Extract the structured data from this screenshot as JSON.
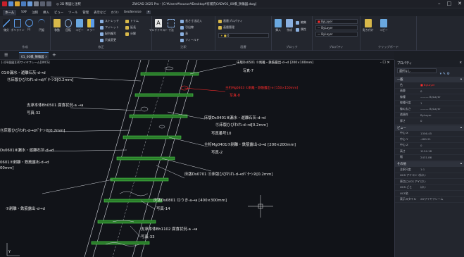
{
  "title_bar": {
    "title": "ZWCAD 2025 Pro - [C:¥Users¥hourun¥Desktop¥有補充CAD¥01_00橋_損傷図.dwg]",
    "tab_label": "◎ 2D 製図と注釈"
  },
  "menu": [
    "ホーム",
    "SXF",
    "注釈",
    "挿入",
    "ビュー",
    "ツール",
    "管理",
    "表示など",
    "ｵﾝﾗｲﾝ",
    "GeoService"
  ],
  "ribbon": {
    "groups": [
      {
        "label": "作成",
        "buttons": [
          "線分",
          "ポリライン",
          "円",
          "円弧"
        ]
      },
      {
        "label": "修正",
        "buttons": [
          "移動",
          "回転",
          "コピー",
          "ミラー",
          "ストレッチ",
          "フィレット",
          "配列複写",
          "尺度変更",
          "トリム",
          "延長",
          "分解"
        ]
      },
      {
        "label": "注釈",
        "buttons": [
          "マルチテキスト",
          "寸法",
          "引出線",
          "表",
          "長さ寸法記入",
          "フィールド"
        ]
      },
      {
        "label": "画層",
        "buttons": [
          "画層プロパティ",
          "画層管理"
        ]
      },
      {
        "label": "ブロック",
        "buttons": [
          "挿入",
          "作成",
          "編集",
          "属性"
        ]
      },
      {
        "label": "プロパティ",
        "buttons": [
          "作成",
          "編集"
        ]
      },
      {
        "label": "ユーティリティ",
        "buttons": [
          "貼り付け"
        ]
      },
      {
        "label": "クリップボード",
        "buttons": [
          "コピー"
        ]
      }
    ],
    "layer_value": "0",
    "bylayer_1": "ByLayer",
    "bylayer_2": "ByLayer",
    "bylayer_3": "ByLayer"
  },
  "doc_tab": "01_00橋_損傷図",
  "canvas": {
    "header": "[-][平面図][2Dワイヤフレーム][WCS]",
    "labels": [
      {
        "text": "床版Ds0501 ①剥離・鉄筋露出-d→d [200×100mm]",
        "color": "#e8e8e8"
      },
      {
        "text": "写真-7",
        "color": "#e8e8e8"
      },
      {
        "text": "01⑧漏水・遊離石灰-d→d",
        "color": "#e8e8e8"
      },
      {
        "text": "⑪床版ひびわれ-d→d/ﾊﾟﾀｰﾝ②[0.2mm]",
        "color": "#e8e8e8"
      },
      {
        "text": "主桁Mg0403 ①剥離・鉄筋露出-e [150×150mm]",
        "color": "#ff2b2b"
      },
      {
        "text": "写真-8",
        "color": "#ff2b2b"
      },
      {
        "text": "支承本体Bh0501 腐食状況-a →a",
        "color": "#e8e8e8"
      },
      {
        "text": "写真-32",
        "color": "#e8e8e8"
      },
      {
        "text": "床版Ds0401⑧漏水・遊離石灰-d→d",
        "color": "#e8e8e8"
      },
      {
        "text": "⑪床版ひびわれ-d→d[0.2mm]",
        "color": "#e8e8e8"
      },
      {
        "text": "写真番号10",
        "color": "#e8e8e8"
      },
      {
        "text": "⑪床版ひびわれ-d→dﾊﾟﾀｰﾝ②[0.2mm]",
        "color": "#e8e8e8"
      },
      {
        "text": "Ds0601⑧漏水・遊離石灰-d→d",
        "color": "#e8e8e8"
      },
      {
        "text": "主桁Mg0401⑦剥離・鉄筋露出-d→d [200×200mm]",
        "color": "#e8e8e8"
      },
      {
        "text": "写真-2",
        "color": "#e8e8e8"
      },
      {
        "text": "0601⑦剥離・鉄筋露出-d→d",
        "color": "#e8e8e8"
      },
      {
        "text": "00mm]",
        "color": "#e8e8e8"
      },
      {
        "text": "床版Ds0701 ⑪床版ひびわれ-d→dﾊﾟﾀｰﾝ②[0.2mm]",
        "color": "#e8e8e8"
      },
      {
        "text": "床版Ds0801 ⑫うき-a→a [400×300mm]",
        "color": "#e8e8e8"
      },
      {
        "text": "写真-14",
        "color": "#e8e8e8"
      },
      {
        "text": "⑦剥離・鉄筋露出-d→d",
        "color": "#e8e8e8"
      },
      {
        "text": "支承本体Bh1102 腐食状況-a →a",
        "color": "#e8e8e8"
      },
      {
        "text": "写真-33",
        "color": "#e8e8e8"
      },
      {
        "text": "Y",
        "color": "#e8e8e8"
      }
    ]
  },
  "properties": {
    "title": "プロパティ",
    "selection": "選択なし",
    "section_general": "一般",
    "general": [
      {
        "k": "色",
        "v": "■ ByLayer"
      },
      {
        "k": "画層",
        "v": "0"
      },
      {
        "k": "線種",
        "v": "——— ByLayer"
      },
      {
        "k": "線種尺度",
        "v": "1"
      },
      {
        "k": "線の太さ",
        "v": "——— ByLayer"
      },
      {
        "k": "透過性",
        "v": "ByLayer"
      },
      {
        "k": "厚さ",
        "v": "0"
      }
    ],
    "section_view": "ビュー",
    "view": [
      {
        "k": "中心 X",
        "v": "1356.45"
      },
      {
        "k": "中心 Y",
        "v": "-480.21"
      },
      {
        "k": "中心 Z",
        "v": "0"
      },
      {
        "k": "高さ",
        "v": "1124.18"
      },
      {
        "k": "幅",
        "v": "2431.86"
      }
    ],
    "section_misc": "その他",
    "misc": [
      {
        "k": "注釈尺度",
        "v": "1:1"
      },
      {
        "k": "UCS アイコン オン",
        "v": "はい"
      },
      {
        "k": "原点にUCS アイコン",
        "v": "はい"
      },
      {
        "k": "UCS ごと",
        "v": "はい"
      },
      {
        "k": "UCS名",
        "v": ""
      },
      {
        "k": "表示スタイル",
        "v": "2Dワイヤフレーム"
      }
    ]
  }
}
